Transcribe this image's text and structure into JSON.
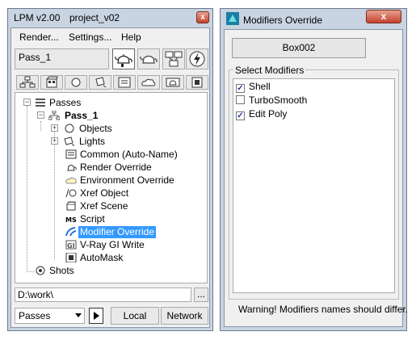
{
  "lpm": {
    "title": "LPM v2.00",
    "project": "project_v02",
    "close_label": "x",
    "menu": [
      "Render...",
      "Settings...",
      "Help"
    ],
    "pass_field": "Pass_1",
    "tree": {
      "root": "Passes",
      "pass": "Pass_1",
      "items": [
        "Objects",
        "Lights",
        "Common (Auto-Name)",
        "Render Override",
        "Environment Override",
        "Xref Object",
        "Xref Scene",
        "Script",
        "Modifier Override",
        "V-Ray GI Write",
        "AutoMask"
      ],
      "shots": "Shots",
      "selected": "Modifier Override"
    },
    "path": "D:\\work\\",
    "browse_label": "...",
    "combo_value": "Passes",
    "local_label": "Local",
    "network_label": "Network"
  },
  "modover": {
    "title": "Modifiers Override",
    "close_label": "x",
    "object_button": "Box002",
    "group_label": "Select Modifiers",
    "modifiers": [
      {
        "label": "Shell",
        "checked": true
      },
      {
        "label": "TurboSmooth",
        "checked": false
      },
      {
        "label": "Edit Poly",
        "checked": true
      }
    ],
    "warning": "Warning! Modifiers names should differ."
  }
}
